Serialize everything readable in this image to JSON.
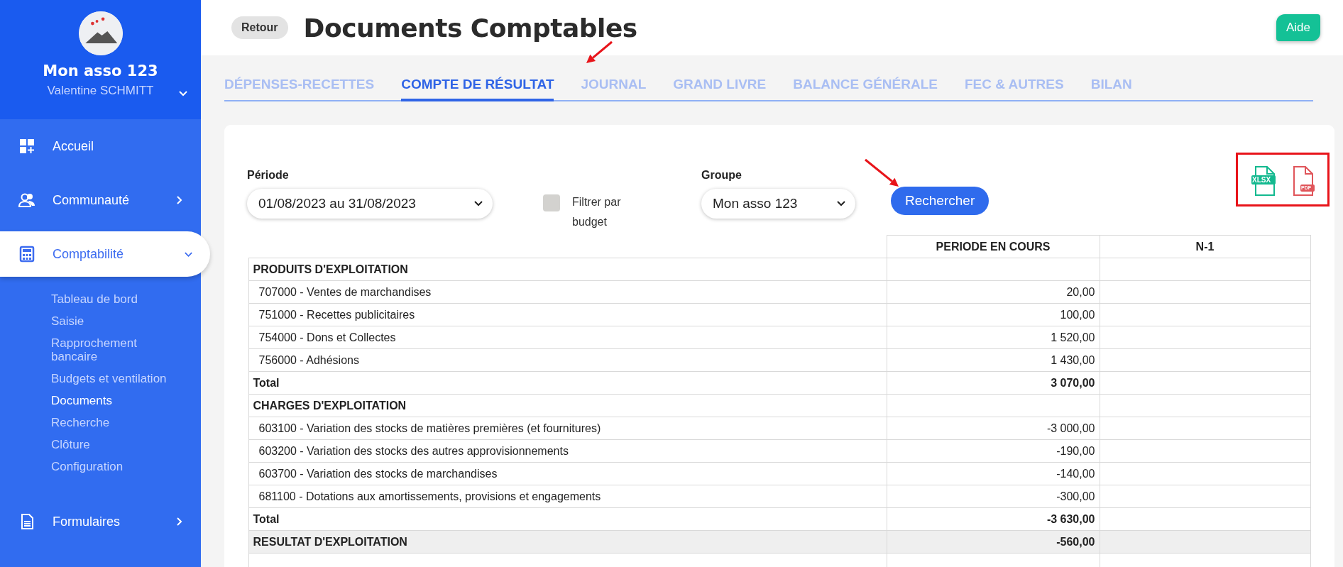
{
  "sidebar": {
    "org_name": "Mon asso 123",
    "user_name": "Valentine SCHMITT",
    "items": [
      {
        "label": "Accueil",
        "kind": "plain",
        "selected": false
      },
      {
        "label": "Communauté",
        "kind": "group",
        "selected": false,
        "expanded": false
      },
      {
        "label": "Comptabilité",
        "kind": "group",
        "selected": true,
        "expanded": true,
        "children": [
          {
            "label": "Tableau de bord",
            "selected": false
          },
          {
            "label": "Saisie",
            "selected": false
          },
          {
            "label": "Rapprochement bancaire",
            "selected": false
          },
          {
            "label": "Budgets et ventilation",
            "selected": false
          },
          {
            "label": "Documents",
            "selected": true
          },
          {
            "label": "Recherche",
            "selected": false
          },
          {
            "label": "Clôture",
            "selected": false
          },
          {
            "label": "Configuration",
            "selected": false
          }
        ]
      },
      {
        "label": "Formulaires",
        "kind": "group",
        "selected": false,
        "expanded": false
      }
    ]
  },
  "header": {
    "back_button": "Retour",
    "title": "Documents Comptables",
    "help_button": "Aide"
  },
  "tabs": [
    {
      "label": "DÉPENSES-RECETTES",
      "selected": false
    },
    {
      "label": "COMPTE DE RÉSULTAT",
      "selected": true
    },
    {
      "label": "JOURNAL",
      "selected": false
    },
    {
      "label": "GRAND LIVRE",
      "selected": false
    },
    {
      "label": "BALANCE GÉNÉRALE",
      "selected": false
    },
    {
      "label": "FEC & AUTRES",
      "selected": false
    },
    {
      "label": "BILAN",
      "selected": false
    }
  ],
  "filters": {
    "period_label": "Période",
    "period_value": "01/08/2023 au 31/08/2023",
    "budget_filter": {
      "label": "Filtrer par budget",
      "checked": false
    },
    "group_label": "Groupe",
    "group_value": "Mon asso 123",
    "search_button": "Rechercher"
  },
  "exports": [
    {
      "kind": "xlsx",
      "label": "XLSX"
    },
    {
      "kind": "pdf",
      "label": "PDF"
    }
  ],
  "table": {
    "columns": [
      "PERIODE EN COURS",
      "N-1"
    ],
    "rows": [
      {
        "kind": "section",
        "label": "PRODUITS D'EXPLOITATION",
        "current": "",
        "previous": ""
      },
      {
        "kind": "account",
        "label": "707000 - Ventes de marchandises",
        "current": "20,00",
        "previous": ""
      },
      {
        "kind": "account",
        "label": "751000 - Recettes publicitaires",
        "current": "100,00",
        "previous": ""
      },
      {
        "kind": "account",
        "label": "754000 - Dons et Collectes",
        "current": "1 520,00",
        "previous": ""
      },
      {
        "kind": "account",
        "label": "756000 - Adhésions",
        "current": "1 430,00",
        "previous": ""
      },
      {
        "kind": "total",
        "label": "Total",
        "current": "3 070,00",
        "previous": ""
      },
      {
        "kind": "section",
        "label": "CHARGES D'EXPLOITATION",
        "current": "",
        "previous": ""
      },
      {
        "kind": "account",
        "label": "603100 - Variation des stocks de matières premières (et fournitures)",
        "current": "-3 000,00",
        "previous": ""
      },
      {
        "kind": "account",
        "label": "603200 - Variation des stocks des autres approvisionnements",
        "current": "-190,00",
        "previous": ""
      },
      {
        "kind": "account",
        "label": "603700 - Variation des stocks de marchandises",
        "current": "-140,00",
        "previous": ""
      },
      {
        "kind": "account",
        "label": "681100 - Dotations aux amortissements, provisions et engagements",
        "current": "-300,00",
        "previous": ""
      },
      {
        "kind": "total",
        "label": "Total",
        "current": "-3 630,00",
        "previous": ""
      },
      {
        "kind": "result",
        "label": "RESULTAT D'EXPLOITATION",
        "current": "-560,00",
        "previous": ""
      },
      {
        "kind": "blank",
        "label": "",
        "current": "",
        "previous": ""
      }
    ]
  }
}
